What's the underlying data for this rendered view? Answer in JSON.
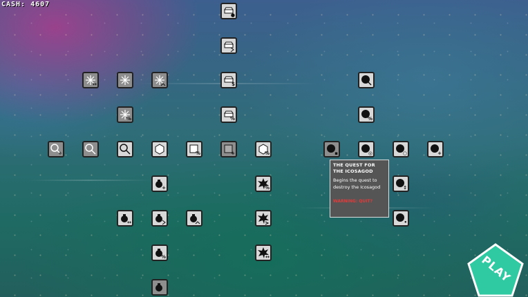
{
  "hud": {
    "cash_label": "CASH: 4607"
  },
  "tooltip": {
    "title": "THE QUEST FOR THE ICOSAGOD",
    "description": "Begins the quest to destroy the Icosagod",
    "warning": "WARNING: QUIT?"
  },
  "play_button": {
    "label": "PLAY",
    "color": "#2fc9a2"
  },
  "upgrade_icons": {
    "money-upgrade": "gold-bar-icon",
    "sparkle-upgrade": "sparkle-icon",
    "magnifier-upgrade": "magnifier-icon",
    "hexagon-upgrade": "hexagon-icon",
    "square-upgrade": "square-icon",
    "bomb-upgrade": "bomb-icon",
    "burst-upgrade": "explosion-icon",
    "orb-upgrade": "orb-icon"
  },
  "node_colors": {
    "unlocked": "#d8d8d8",
    "locked": "#8e8e8e",
    "border": "#222222"
  }
}
